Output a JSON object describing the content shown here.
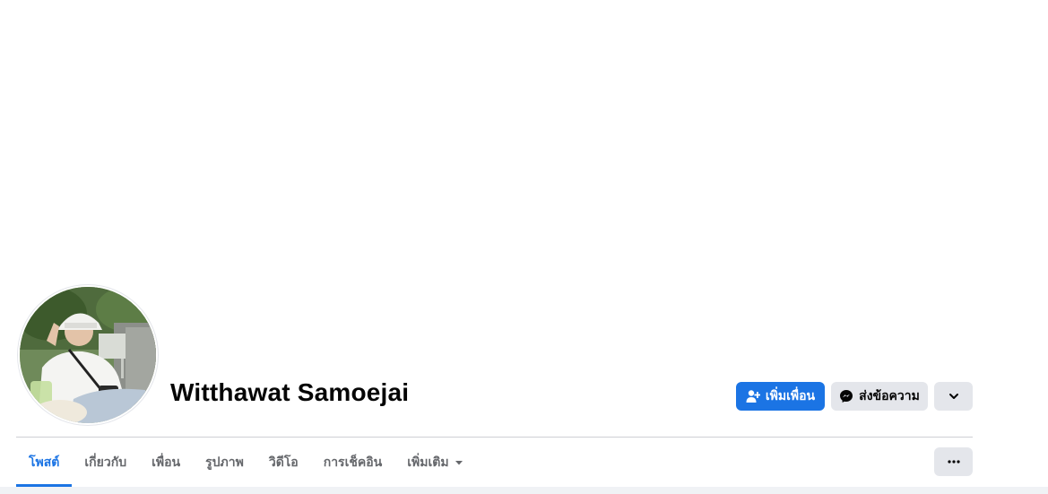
{
  "profile": {
    "name": "Witthawat Samoejai"
  },
  "actions": {
    "add_friend_label": "เพิ่มเพื่อน",
    "add_friend_icon": "person-add-icon",
    "message_label": "ส่งข้อความ",
    "message_icon": "messenger-icon",
    "chevron_icon": "chevron-down-icon"
  },
  "tabs": [
    {
      "label": "โพสต์",
      "active": true
    },
    {
      "label": "เกี่ยวกับ",
      "active": false
    },
    {
      "label": "เพื่อน",
      "active": false
    },
    {
      "label": "รูปภาพ",
      "active": false
    },
    {
      "label": "วิดีโอ",
      "active": false
    },
    {
      "label": "การเช็คอิน",
      "active": false
    },
    {
      "label": "เพิ่มเติม",
      "active": false
    }
  ],
  "more_options_icon": "ellipsis-icon",
  "colors": {
    "accent": "#1b74e4",
    "secondary_button": "#e4e6eb",
    "muted_text": "#65676b",
    "page_background": "#f0f2f5"
  }
}
